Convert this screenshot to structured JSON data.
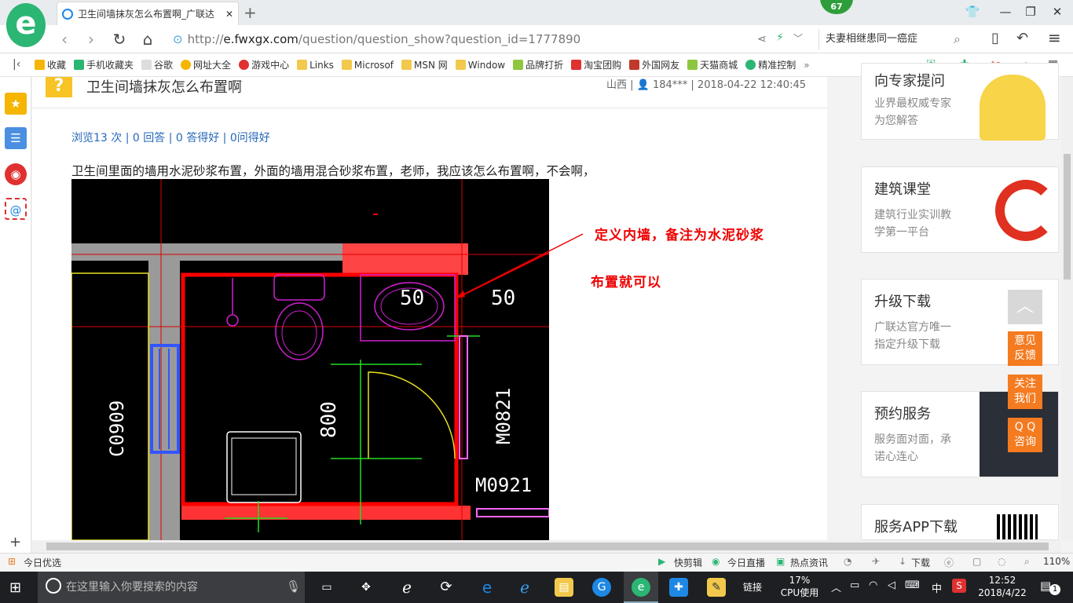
{
  "browser": {
    "tab_title": "卫生间墙抹灰怎么布置啊_广联达",
    "tab_close": "✕",
    "new_tab": "+",
    "badge_count": "67",
    "url_scheme": "http://",
    "url_host": "e.fwxgx.com",
    "url_path": "/question/question_show?question_id=1777890",
    "search_text": "夫妻相继患同一癌症"
  },
  "bookmarks": [
    {
      "label": "收藏",
      "color": "#f6b500"
    },
    {
      "label": "手机收藏夹",
      "color": "#2bb673"
    },
    {
      "label": "谷歌",
      "color": "#bbbbbb"
    },
    {
      "label": "网址大全",
      "color": "#f6b500"
    },
    {
      "label": "游戏中心",
      "color": "#e03030"
    },
    {
      "label": "Links",
      "color": "#f2c94c"
    },
    {
      "label": "Microsof",
      "color": "#f2c94c"
    },
    {
      "label": "MSN 网",
      "color": "#f2c94c"
    },
    {
      "label": "Window",
      "color": "#f2c94c"
    },
    {
      "label": "品牌打折",
      "color": "#8dc63f"
    },
    {
      "label": "淘宝团购",
      "color": "#e03030"
    },
    {
      "label": "外国网友",
      "color": "#c0392b"
    },
    {
      "label": "天猫商城",
      "color": "#8dc63f"
    },
    {
      "label": "精准控制",
      "color": "#2bb673"
    }
  ],
  "question": {
    "title": "卫生间墙抹灰怎么布置啊",
    "meta": "山西 | 👤 184*** | 2018-04-22 12:40:45",
    "stats": "浏览13 次 | 0 回答 | 0 答得好 | 0问得好",
    "body": "卫生间里面的墙用水泥砂浆布置，外面的墙用混合砂浆布置，老师，我应该怎么布置啊，不会啊，",
    "annotation_line1": "定义内墙，备注为水泥砂浆",
    "annotation_line2": "布置就可以",
    "cad_labels": {
      "dim_50a": "50",
      "dim_50b": "50",
      "dim_800": "800",
      "window": "C0909",
      "door1": "M0821",
      "door2": "M0921"
    }
  },
  "sidebar_cards": [
    {
      "title": "向专家提问",
      "line1": "业界最权威专家",
      "line2": "为您解答"
    },
    {
      "title": "建筑课堂",
      "line1": "建筑行业实训教",
      "line2": "学第一平台"
    },
    {
      "title": "升级下载",
      "line1": "广联达官方唯一",
      "line2": "指定升级下载"
    },
    {
      "title": "预约服务",
      "line1": "服务面对面，承",
      "line2": "诺心连心"
    },
    {
      "title": "服务APP下载",
      "line1": "",
      "line2": ""
    }
  ],
  "float_buttons": {
    "top": "︿",
    "feedback": "意见\n反馈",
    "follow": "关注\n我们",
    "qq": "Q Q\n咨询"
  },
  "statusbar": {
    "left": "今日优选",
    "quick_cut": "快剪辑",
    "live": "今日直播",
    "news": "热点资讯",
    "download": "下载",
    "zoom": "110%"
  },
  "taskbar": {
    "search_placeholder": "在这里输入你要搜索的内容",
    "links": "链接",
    "cpu_percent": "17%",
    "cpu_label": "CPU使用",
    "ime": "中",
    "time": "12:52",
    "date": "2018/4/22",
    "notification_count": "1"
  }
}
